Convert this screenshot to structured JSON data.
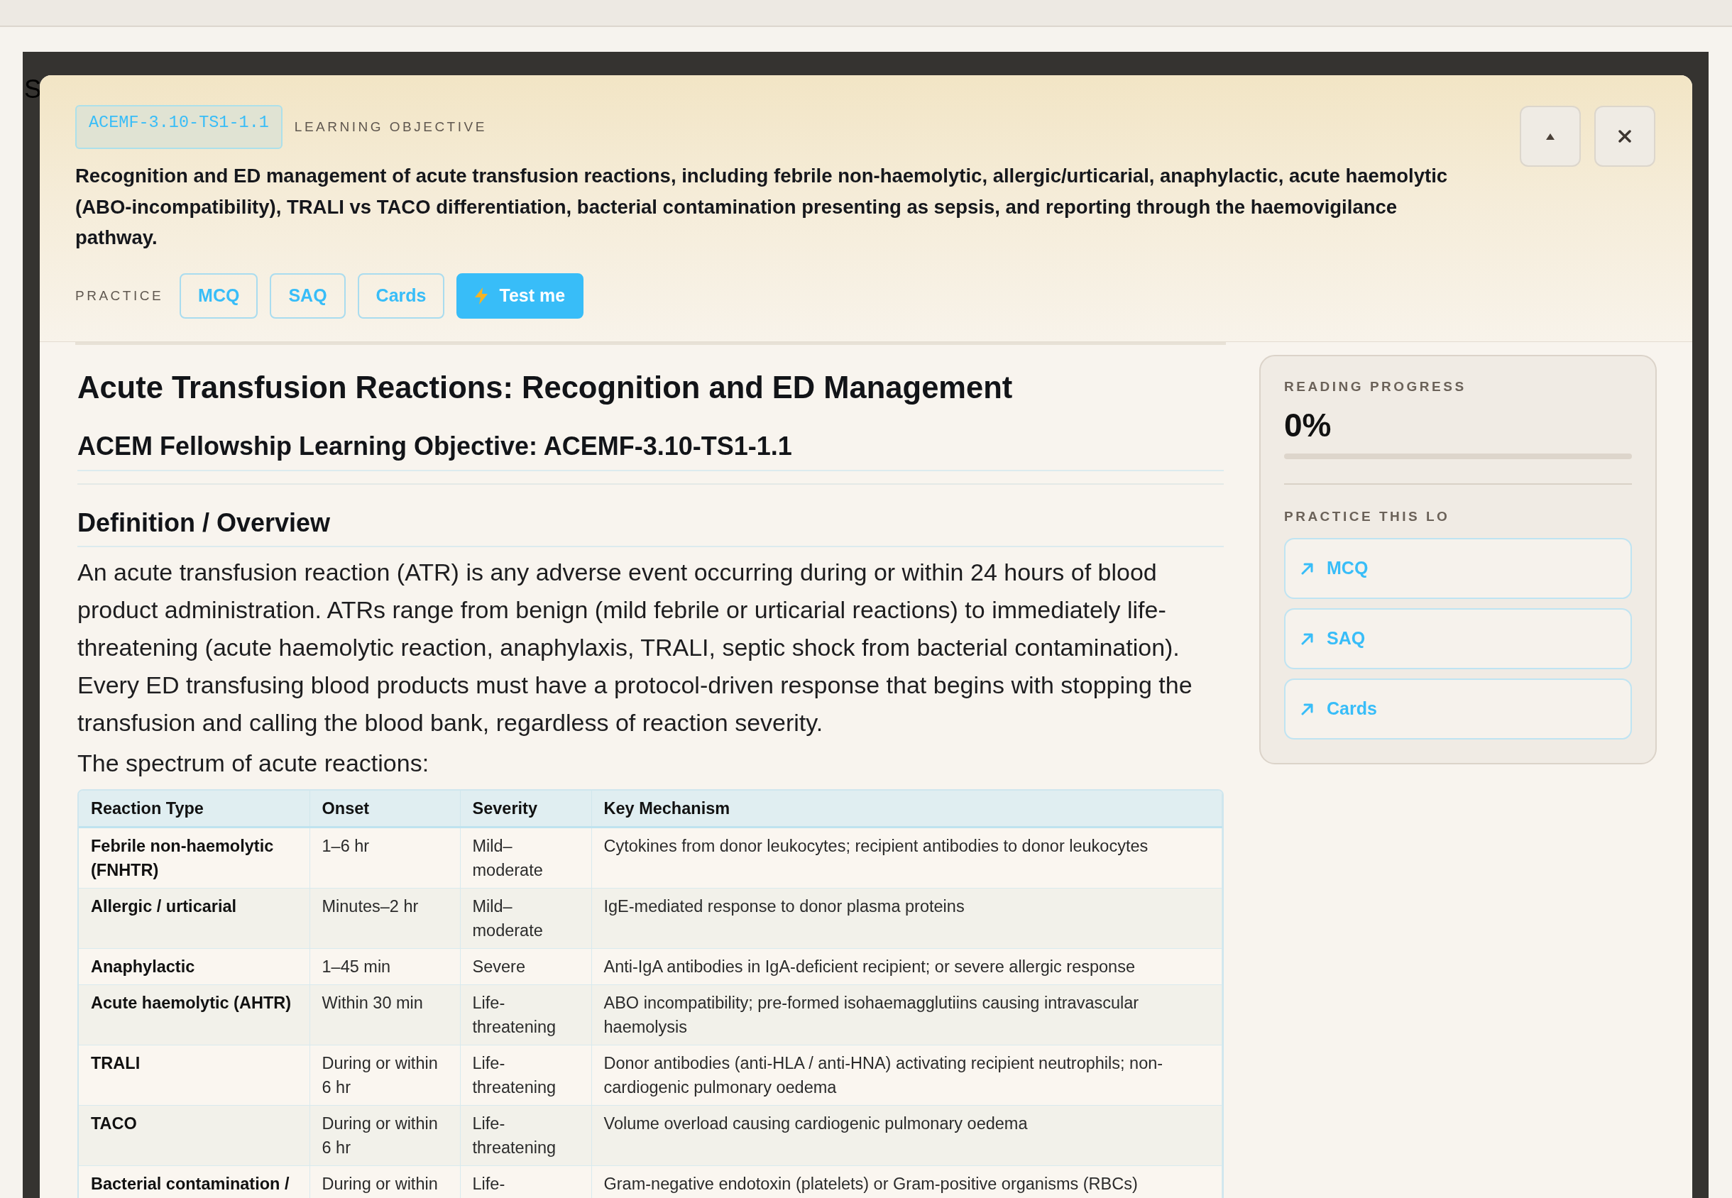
{
  "backdrop": {
    "text": "S"
  },
  "objective_header": {
    "code": "ACEMF-3.10-TS1-1.1",
    "label": "LEARNING OBJECTIVE",
    "text": "Recognition and ED management of acute transfusion reactions, including febrile non-haemolytic, allergic/urticarial, anaphylactic, acute haemolytic (ABO-incompatibility), TRALI vs TACO differentiation, bacterial contamination presenting as sepsis, and reporting through the haemovigilance pathway.",
    "practice_label": "PRACTICE",
    "practice_buttons": [
      {
        "label": "MCQ",
        "kind": "outline"
      },
      {
        "label": "SAQ",
        "kind": "outline"
      },
      {
        "label": "Cards",
        "kind": "outline"
      },
      {
        "label": "Test me",
        "kind": "primary"
      }
    ]
  },
  "article": {
    "title": "Acute Transfusion Reactions: Recognition and ED Management",
    "subtitle": "ACEM Fellowship Learning Objective: ACEMF-3.10-TS1-1.1",
    "sections": [
      {
        "heading": "Definition / Overview",
        "paragraphs": [
          "An acute transfusion reaction (ATR) is any adverse event occurring during or within 24 hours of blood product administration. ATRs range from benign (mild febrile or urticarial reactions) to immediately life-threatening (acute haemolytic reaction, anaphylaxis, TRALI, septic shock from bacterial contamination). Every ED transfusing blood products must have a protocol-driven response that begins with stopping the transfusion and calling the blood bank, regardless of reaction severity.",
          "The spectrum of acute reactions:"
        ],
        "table": {
          "columns": [
            "Reaction Type",
            "Onset",
            "Severity",
            "Key Mechanism"
          ],
          "rows": [
            [
              "Febrile non-haemolytic (FNHTR)",
              "1–6 hr",
              "Mild–moderate",
              "Cytokines from donor leukocytes; recipient antibodies to donor leukocytes"
            ],
            [
              "Allergic / urticarial",
              "Minutes–2 hr",
              "Mild–moderate",
              "IgE-mediated response to donor plasma proteins"
            ],
            [
              "Anaphylactic",
              "1–45 min",
              "Severe",
              "Anti-IgA antibodies in IgA-deficient recipient; or severe allergic response"
            ],
            [
              "Acute haemolytic (AHTR)",
              "Within 30 min",
              "Life-threatening",
              "ABO incompatibility; pre-formed isohaemagglutiins causing intravascular haemolysis"
            ],
            [
              "TRALI",
              "During or within 6 hr",
              "Life-threatening",
              "Donor antibodies (anti-HLA / anti-HNA) activating recipient neutrophils; non-cardiogenic pulmonary oedema"
            ],
            [
              "TACO",
              "During or within 6 hr",
              "Life-threatening",
              "Volume overload causing cardiogenic pulmonary oedema"
            ],
            [
              "Bacterial contamination /",
              "During or within",
              "Life-",
              "Gram-negative endotoxin (platelets) or Gram-positive organisms (RBCs)"
            ]
          ]
        }
      }
    ]
  },
  "sidebar": {
    "progress_label": "READING PROGRESS",
    "progress_value": "0%",
    "level": 0,
    "practice_label": "PRACTICE THIS LO",
    "links": [
      {
        "label": "MCQ"
      },
      {
        "label": "SAQ"
      },
      {
        "label": "Cards"
      }
    ]
  }
}
